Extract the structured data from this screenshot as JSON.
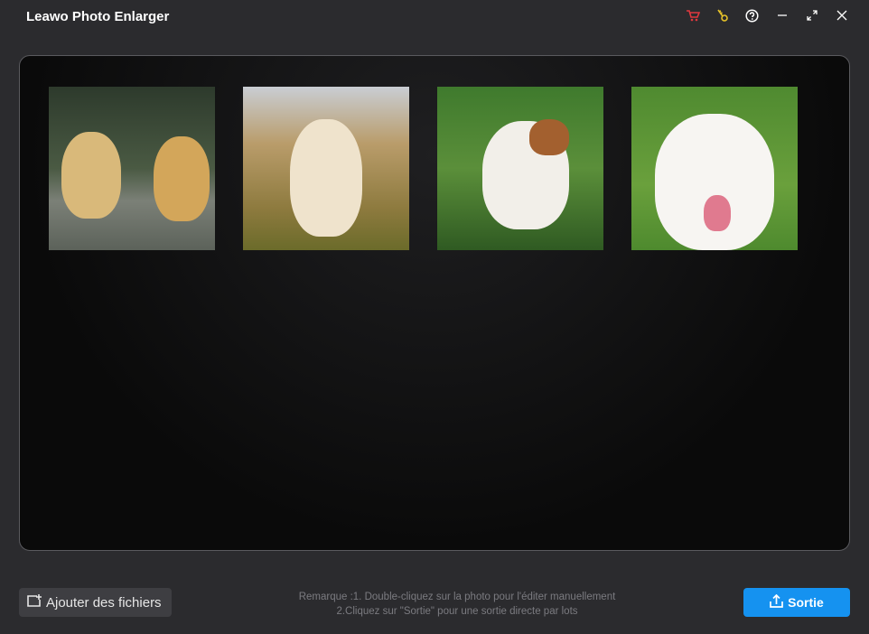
{
  "window": {
    "title": "Leawo Photo Enlarger"
  },
  "controls": {
    "cart": "cart-icon",
    "key": "key-icon",
    "help": "help-icon",
    "minimize": "minimize-icon",
    "maximize": "maximize-icon",
    "close": "close-icon"
  },
  "photos": [
    "two puppies",
    "golden retriever puppy",
    "white and brown puppy",
    "smiling dog"
  ],
  "footer": {
    "add_label": "Ajouter des fichiers",
    "note_line1": "Remarque :1. Double-cliquez sur la photo pour l'éditer manuellement",
    "note_line2": "2.Cliquez sur \"Sortie\" pour une sortie directe par lots",
    "output_label": "Sortie"
  },
  "colors": {
    "accent": "#1592f0",
    "cart": "#e0383e",
    "key": "#e6c229"
  }
}
